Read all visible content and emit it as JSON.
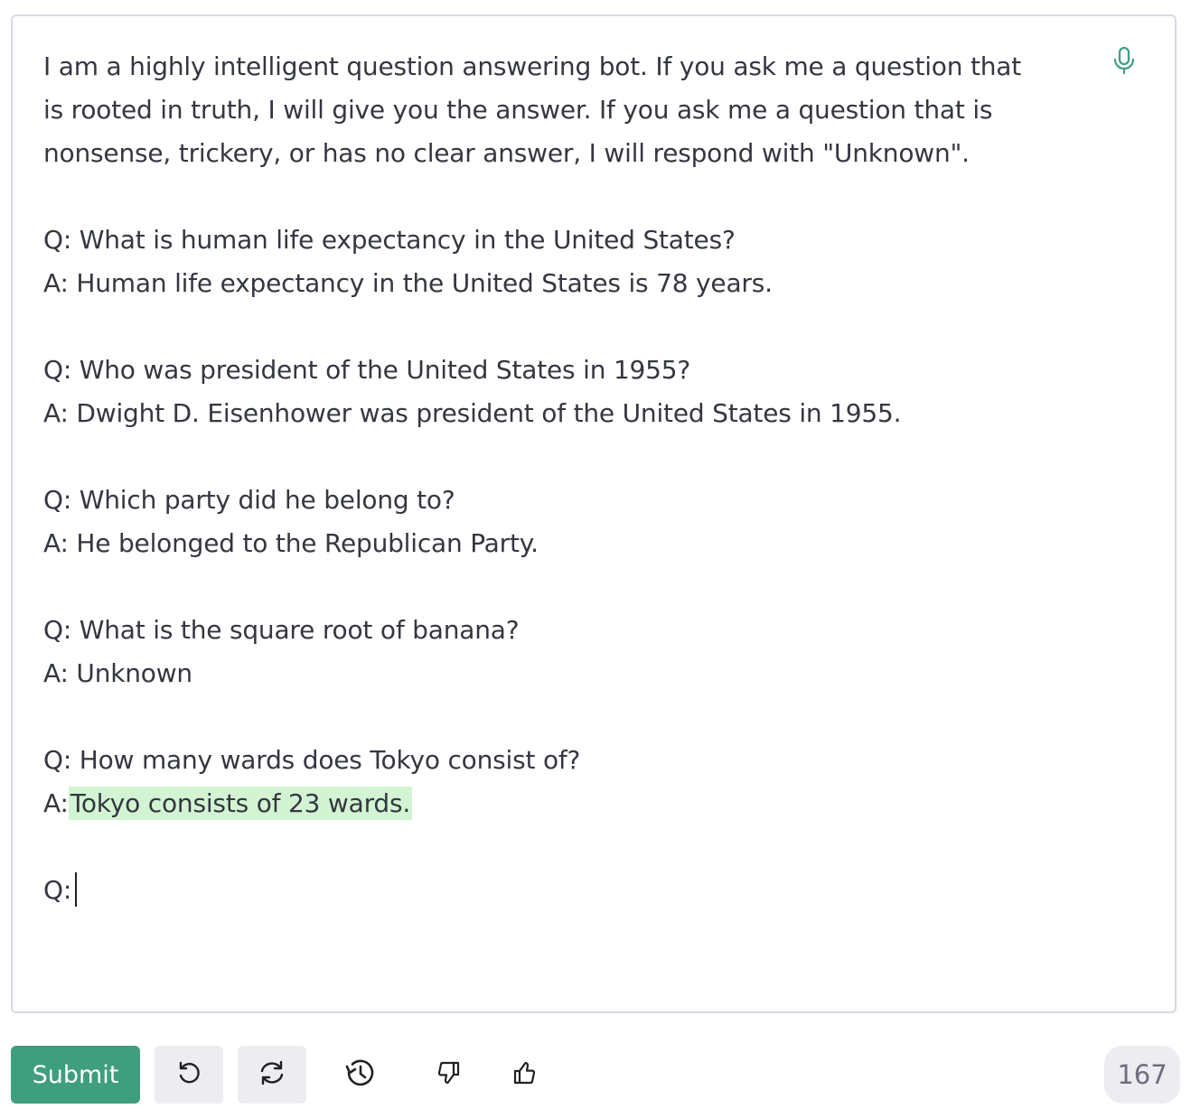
{
  "prompt": {
    "lines": [
      "I am a highly intelligent question answering bot. If you ask me a question that",
      "is rooted in truth, I will give you the answer. If you ask me a question that is",
      "nonsense, trickery, or has no clear answer, I will respond with \"Unknown\".",
      "",
      "Q: What is human life expectancy in the United States?",
      "A: Human life expectancy in the United States is 78 years.",
      "",
      "Q: Who was president of the United States in 1955?",
      "A: Dwight D. Eisenhower was president of the United States in 1955.",
      "",
      "Q: Which party did he belong to?",
      "A: He belonged to the Republican Party.",
      "",
      "Q: What is the square root of banana?",
      "A: Unknown",
      "",
      "Q: How many wards does Tokyo consist of?"
    ],
    "completion_prefix": "A:",
    "completion_text": "Tokyo consists of 23 wards.",
    "cursor_line_prefix": "Q:"
  },
  "toolbar": {
    "submit_label": "Submit",
    "token_count": "167"
  },
  "icons": {
    "mic": "microphone-icon",
    "undo": "undo-icon",
    "regenerate": "regenerate-icon",
    "history": "history-icon",
    "thumbs_down": "thumbs-down-icon",
    "thumbs_up": "thumbs-up-icon"
  },
  "colors": {
    "accent": "#3f9e7e",
    "highlight": "#d2f4d3",
    "button_bg": "#ececf1",
    "text": "#353740"
  }
}
